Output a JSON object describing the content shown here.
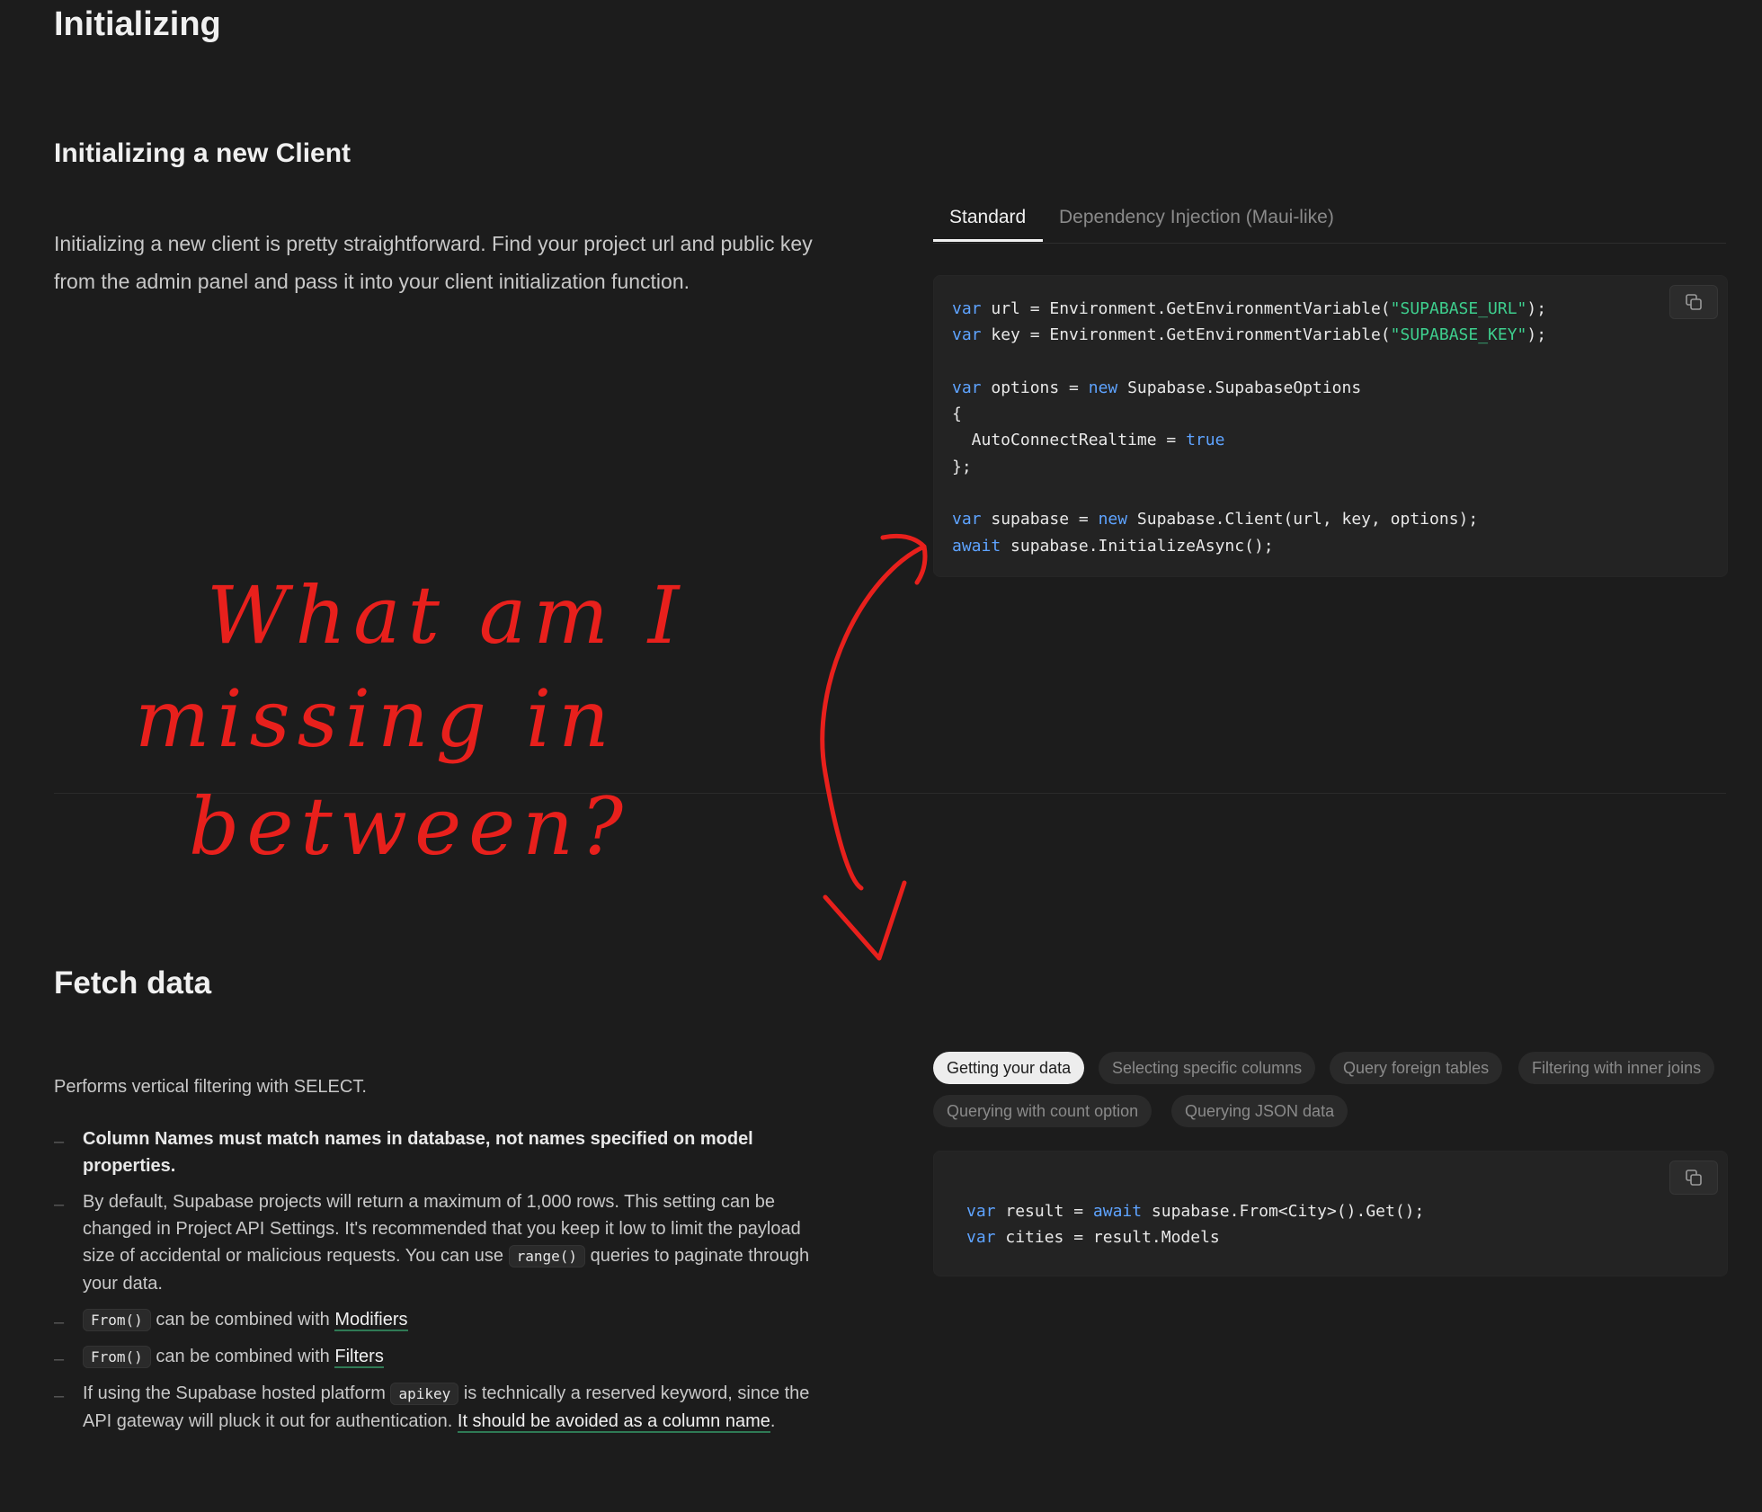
{
  "page": {
    "title": "Initializing",
    "subtitle": "Initializing a new Client",
    "intro": "Initializing a new client is pretty straightforward. Find your project url and public key from the admin panel and pass it into your client initialization function."
  },
  "init_tabs": [
    {
      "label": "Standard",
      "active": true
    },
    {
      "label": "Dependency Injection (Maui-like)",
      "active": false
    }
  ],
  "init_code": {
    "lines": [
      "var url = Environment.GetEnvironmentVariable(\"SUPABASE_URL\");",
      "var key = Environment.GetEnvironmentVariable(\"SUPABASE_KEY\");",
      "",
      "var options = new Supabase.SupabaseOptions",
      "{",
      "  AutoConnectRealtime = true",
      "};",
      "",
      "var supabase = new Supabase.Client(url, key, options);",
      "await supabase.InitializeAsync();"
    ]
  },
  "annotation": {
    "text": "What am I missing in between?",
    "color": "#e8201c"
  },
  "fetch": {
    "title": "Fetch data",
    "description": "Performs vertical filtering with SELECT.",
    "notes": {
      "n1": "Column Names must match names in database, not names specified on model properties.",
      "n2_a": "By default, Supabase projects will return a maximum of 1,000 rows. This setting can be changed in Project API Settings. It's recommended that you keep it low to limit the payload size of accidental or malicious requests. You can use",
      "n2_code": "range()",
      "n2_b": "queries to paginate through your data.",
      "n3_code": "From()",
      "n3_text": "can be combined with",
      "n3_link": "Modifiers",
      "n4_code": "From()",
      "n4_text": "can be combined with",
      "n4_link": "Filters",
      "n5_a": "If using the Supabase hosted platform",
      "n5_code": "apikey",
      "n5_b": "is technically a reserved keyword, since the API gateway will pluck it out for authentication.",
      "n5_link": "It should be avoided as a column name",
      "n5_end": "."
    },
    "pills": [
      {
        "label": "Getting your data",
        "active": true
      },
      {
        "label": "Selecting specific columns",
        "active": false
      },
      {
        "label": "Query foreign tables",
        "active": false
      },
      {
        "label": "Filtering with inner joins",
        "active": false
      },
      {
        "label": "Querying with count option",
        "active": false
      },
      {
        "label": "Querying JSON data",
        "active": false
      }
    ],
    "code_lines": [
      "var result = await supabase.From<City>().Get();",
      "var cities = result.Models"
    ]
  },
  "colors": {
    "background": "#1c1c1c",
    "code_background": "#232323",
    "keyword": "#5ea3ff",
    "string": "#3ecf8e",
    "link_underline": "#2f7a55"
  },
  "icons": {
    "copy": "copy-icon"
  }
}
